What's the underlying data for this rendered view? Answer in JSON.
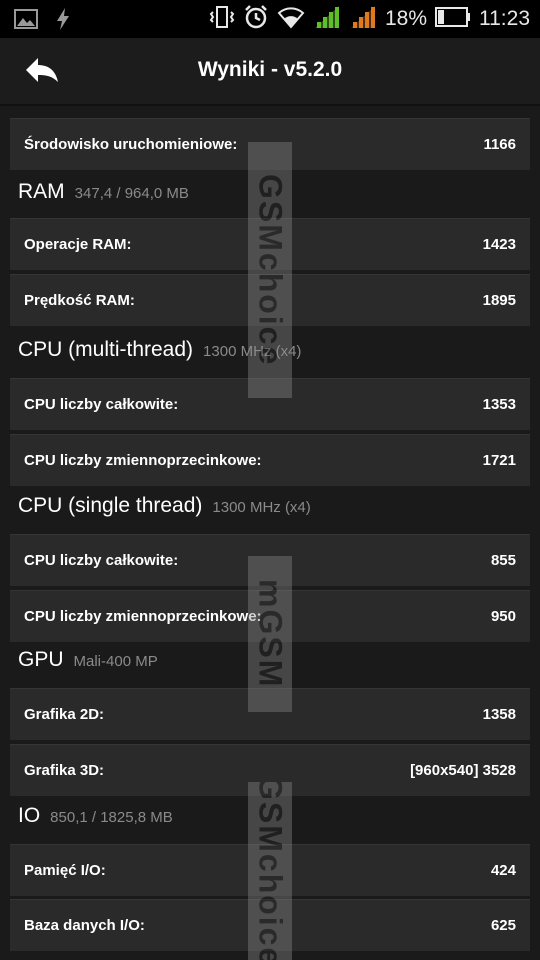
{
  "status_bar": {
    "icons": [
      "image-icon",
      "flash-icon",
      "vibrate-icon",
      "alarm-icon",
      "wifi-icon",
      "signal-icon-sim1",
      "signal-icon-sim2",
      "battery-icon"
    ],
    "battery_percent": "18%",
    "time": "11:23"
  },
  "action_bar": {
    "back_icon": "back-arrow-icon",
    "title": "Wyniki - v5.2.0"
  },
  "rows_top": [
    {
      "label": "Środowisko uruchomieniowe:",
      "value": "1166"
    }
  ],
  "sections": [
    {
      "title": "RAM",
      "subtitle": "347,4 / 964,0 MB",
      "rows": [
        {
          "label": "Operacje RAM:",
          "value": "1423"
        },
        {
          "label": "Prędkość RAM:",
          "value": "1895"
        }
      ]
    },
    {
      "title": "CPU (multi-thread)",
      "subtitle": "1300 MHz (x4)",
      "rows": [
        {
          "label": "CPU liczby całkowite:",
          "value": "1353"
        },
        {
          "label": "CPU liczby zmiennoprzecinkowe:",
          "value": "1721"
        }
      ]
    },
    {
      "title": "CPU (single thread)",
      "subtitle": "1300 MHz (x4)",
      "rows": [
        {
          "label": "CPU liczby całkowite:",
          "value": "855"
        },
        {
          "label": "CPU liczby zmiennoprzecinkowe:",
          "value": "950"
        }
      ]
    },
    {
      "title": "GPU",
      "subtitle": "Mali-400 MP",
      "rows": [
        {
          "label": "Grafika 2D:",
          "value": "1358"
        },
        {
          "label": "Grafika 3D:",
          "value": "[960x540] 3528"
        }
      ]
    },
    {
      "title": "IO",
      "subtitle": "850,1 / 1825,8 MB",
      "rows": [
        {
          "label": "Pamięć I/O:",
          "value": "424"
        },
        {
          "label": "Baza danych I/O:",
          "value": "625"
        }
      ]
    }
  ],
  "watermark": {
    "text_1": "GSMchoice",
    "text_2": "mGSM",
    "text_3": "GSMchoice"
  },
  "colors": {
    "background": "#1a1a1a",
    "row_background": "#2a2a2a",
    "subtitle": "#8a8a8a",
    "signal_green": "#5fbf2a",
    "signal_orange": "#e07a1f"
  }
}
